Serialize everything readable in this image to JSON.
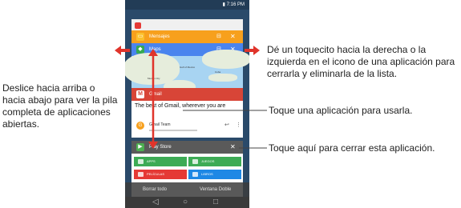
{
  "status_bar": {
    "time": "7:16 PM"
  },
  "cards": {
    "mensajes": {
      "title": "Mensajes"
    },
    "maps": {
      "title": "Maps",
      "map_labels": [
        "Mexico City",
        "Gulf of Mexico",
        "Cuba"
      ]
    },
    "gmail": {
      "title": "Gmail",
      "preview": "The best of Gmail, wherever you are",
      "sender": "Gmail Team",
      "avatar_letter": "G"
    },
    "play_store": {
      "title": "Play Store",
      "tiles": [
        "APPS",
        "JUEGOS",
        "PELÍCULAS",
        "LIBROS"
      ]
    }
  },
  "bottom_options": {
    "clear_all": "Borrar todo",
    "dual_window": "Ventana Doble"
  },
  "icons": {
    "close": "close-icon",
    "dual_window": "window-icon",
    "back": "back-icon",
    "home": "home-icon",
    "recents": "recents-icon",
    "reply": "reply-icon",
    "more": "more-icon"
  },
  "annotations": {
    "swipe_stack": "Deslice hacia arriba o hacia abajo para ver la pila completa de aplicaciones abiertas.",
    "swipe_close": "Dé un toquecito hacia la derecha o la izquierda en el icono de una aplicación para cerrarla y eliminarla de la lista.",
    "tap_use": "Toque una aplicación para usarla.",
    "tap_close": "Toque aquí para cerrar esta aplicación."
  },
  "colors": {
    "arrow_red": "#e0342b",
    "mensajes": "#f7a01d",
    "maps": "#4a84ee",
    "gmail": "#d84537",
    "play_store": "#5a5a5a",
    "tile_apps": "#3dab55",
    "tile_juegos": "#3dab55",
    "tile_peliculas": "#e53935",
    "tile_libros": "#1e88e5"
  }
}
